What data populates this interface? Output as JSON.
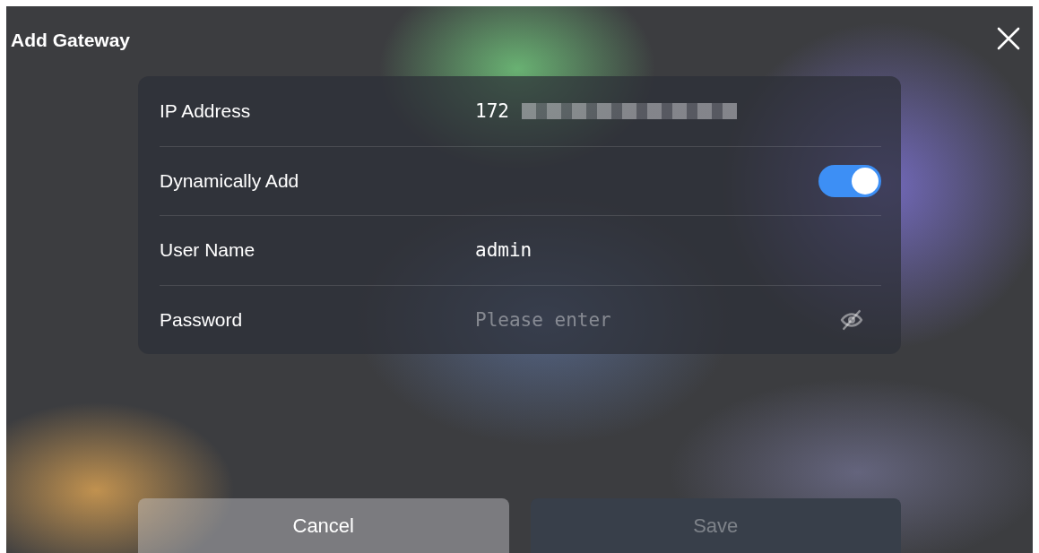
{
  "dialog": {
    "title": "Add Gateway"
  },
  "rows": [
    {
      "kind": "text",
      "label": "IP Address",
      "value": "172",
      "redacted": true
    },
    {
      "kind": "toggle",
      "label": "Dynamically Add",
      "on": true
    },
    {
      "kind": "input",
      "label": "User Name",
      "value": "admin"
    },
    {
      "kind": "password",
      "label": "Password",
      "placeholder": "Please enter",
      "visible": false
    }
  ],
  "buttons": [
    {
      "label": "Cancel",
      "kind": "secondary",
      "disabled": false
    },
    {
      "label": "Save",
      "kind": "primary",
      "disabled": true
    }
  ]
}
